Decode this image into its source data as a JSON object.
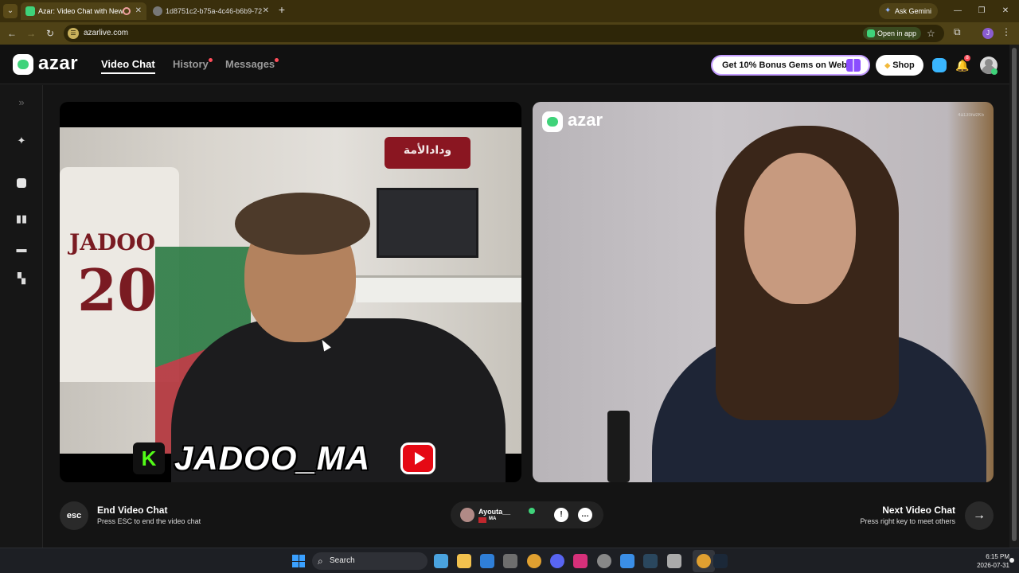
{
  "browser": {
    "tabs": [
      {
        "title": "Azar: Video Chat with New",
        "active": true
      },
      {
        "title": "1d8751c2-b75a-4c46-b6b9-72",
        "active": false
      }
    ],
    "ask_gemini": "Ask Gemini",
    "url": "azarlive.com",
    "open_in_app": "Open in app",
    "profile_initial": "J"
  },
  "app": {
    "logo": "azar",
    "nav": [
      {
        "label": "Video Chat",
        "active": true,
        "dot": false
      },
      {
        "label": "History",
        "active": false,
        "dot": true
      },
      {
        "label": "Messages",
        "active": false,
        "dot": true
      }
    ],
    "promo": "Get 10% Bonus Gems on Web!",
    "shop": "Shop",
    "bell_badge": "8"
  },
  "video": {
    "left_overlay_name": "JADOO_MA",
    "left_kick_glyph": "K",
    "jersey_name": "JADOO",
    "jersey_number": "20",
    "watermark_logo": "azar",
    "watermark_id": "4a130iwzK5"
  },
  "bottom": {
    "esc_label": "esc",
    "end_title": "End Video Chat",
    "end_sub": "Press ESC to end the video chat",
    "peer_name": "Ayouta__",
    "peer_country": "MA",
    "next_title": "Next Video Chat",
    "next_sub": "Press right key to meet others"
  },
  "taskbar": {
    "search_placeholder": "Search",
    "time": "6:15 PM",
    "date": "2026-07-31"
  },
  "colors": {
    "accent_green": "#3fd37a",
    "notification_red": "#ff4d5a",
    "chrome_frame": "#4f4216",
    "promo_border": "#c39cff"
  },
  "icons": [
    "tab-search-icon",
    "close-icon",
    "new-tab-icon",
    "back-icon",
    "forward-icon",
    "reload-icon",
    "star-icon",
    "extensions-icon",
    "more-icon",
    "gift-icon",
    "chat-icon",
    "bell-icon",
    "expand-icon",
    "magic-wand-icon",
    "swap-icon",
    "split-vertical-icon",
    "split-horizontal-icon",
    "grid-icon",
    "shield-icon",
    "message-icon",
    "arrow-right-icon",
    "windows-start-icon"
  ]
}
